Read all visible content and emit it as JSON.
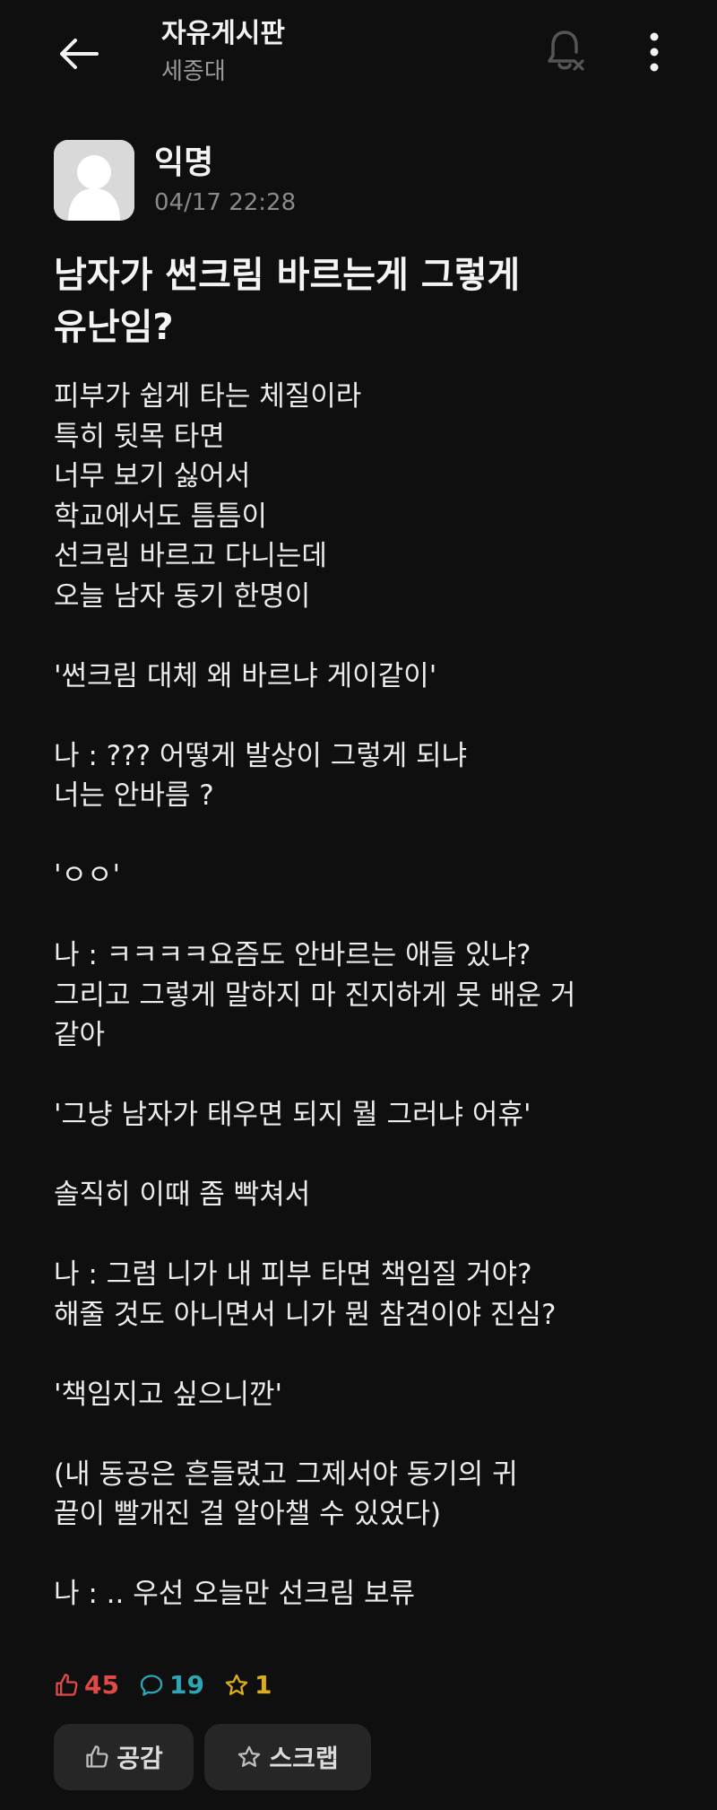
{
  "header": {
    "board_title": "자유게시판",
    "school": "세종대"
  },
  "author": {
    "name": "익명",
    "time": "04/17 22:28"
  },
  "post": {
    "title_lines": [
      "남자가 썬크림 바르는게 그렇게",
      "유난임?"
    ],
    "body_lines": [
      "피부가 쉽게 타는 체질이라",
      "특히 뒷목 타면",
      "너무 보기 싫어서",
      "학교에서도 틈틈이",
      "선크림 바르고 다니는데",
      "오늘 남자 동기 한명이",
      "",
      "'썬크림 대체 왜 바르냐 게이같이'",
      "",
      "나 : ??? 어떻게 발상이 그렇게 되냐",
      "너는 안바름 ?",
      "",
      "'ㅇㅇ'",
      "",
      "나 : ㅋㅋㅋㅋ요즘도 안바르는 애들 있냐?",
      "그리고 그렇게 말하지 마 진지하게 못 배운 거",
      "같아",
      "",
      "'그냥 남자가 태우면 되지 뭘 그러냐 어휴'",
      "",
      "솔직히 이때 좀 빡쳐서",
      "",
      "나 : 그럼 니가 내 피부 타면 책임질 거야?",
      "해줄 것도 아니면서 니가 뭔 참견이야 진심?",
      "",
      "'책임지고 싶으니깐'",
      "",
      "(내 동공은 흔들렸고 그제서야 동기의 귀",
      "끝이 빨개진 걸 알아챌 수 있었다)",
      "",
      "나 : .. 우선 오늘만 선크림 보류"
    ]
  },
  "stats": {
    "likes": "45",
    "comments": "19",
    "scraps": "1"
  },
  "actions": {
    "like_label": "공감",
    "scrap_label": "스크랩"
  },
  "colors": {
    "like": "#e04a46",
    "comment": "#2ea5b5",
    "scrap": "#d9ad1f"
  },
  "icons": {
    "back": "arrow-left-icon",
    "bell": "bell-off-icon",
    "more": "more-vertical-icon",
    "like": "thumbs-up-icon",
    "comment": "comment-icon",
    "scrap": "star-icon"
  }
}
